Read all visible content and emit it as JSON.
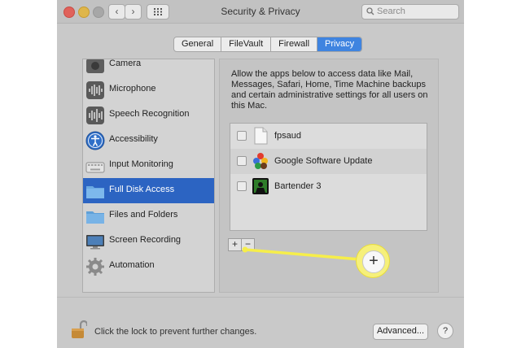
{
  "window": {
    "title": "Security & Privacy",
    "search_placeholder": "Search",
    "nav_back": "‹",
    "nav_forward": "›"
  },
  "tabs": [
    {
      "label": "General",
      "active": false
    },
    {
      "label": "FileVault",
      "active": false
    },
    {
      "label": "Firewall",
      "active": false
    },
    {
      "label": "Privacy",
      "active": true
    }
  ],
  "sidebar": {
    "items": [
      {
        "label": "Camera",
        "icon": "camera-icon"
      },
      {
        "label": "Microphone",
        "icon": "microphone-icon"
      },
      {
        "label": "Speech Recognition",
        "icon": "speech-recognition-icon"
      },
      {
        "label": "Accessibility",
        "icon": "accessibility-icon"
      },
      {
        "label": "Input Monitoring",
        "icon": "keyboard-icon"
      },
      {
        "label": "Full Disk Access",
        "icon": "folder-icon",
        "selected": true
      },
      {
        "label": "Files and Folders",
        "icon": "folder-icon"
      },
      {
        "label": "Screen Recording",
        "icon": "monitor-icon"
      },
      {
        "label": "Automation",
        "icon": "gear-icon"
      }
    ]
  },
  "panel": {
    "description": "Allow the apps below to access data like Mail, Messages, Safari, Home, Time Machine backups and certain administrative settings for all users on this Mac.",
    "apps": [
      {
        "name": "fpsaud",
        "checked": false,
        "icon": "document-icon"
      },
      {
        "name": "Google Software Update",
        "checked": false,
        "icon": "google-update-icon"
      },
      {
        "name": "Bartender 3",
        "checked": false,
        "icon": "bartender-icon"
      }
    ],
    "add_label": "+",
    "remove_label": "−",
    "callout_add_label": "+"
  },
  "bottom": {
    "lock_text": "Click the lock to prevent further changes.",
    "advanced_label": "Advanced...",
    "help_label": "?"
  },
  "colors": {
    "accent": "#3f84e0",
    "selected_row": "#2c64c2",
    "callout": "#f6ee4a"
  }
}
